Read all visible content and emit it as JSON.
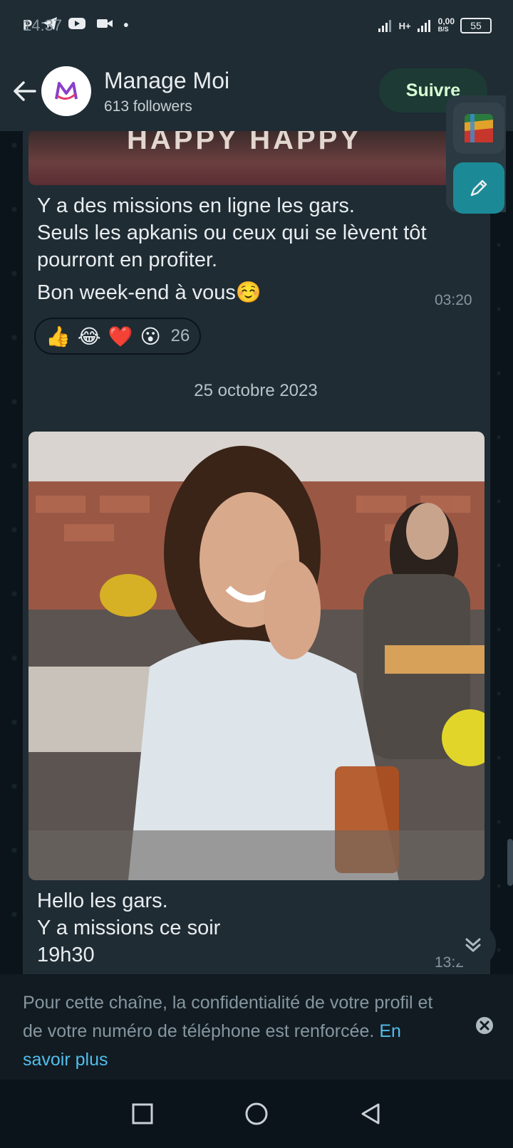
{
  "status_bar": {
    "time": "14:37",
    "network": "H+",
    "speed_value": "0,00",
    "speed_unit": "B/S",
    "battery": "55"
  },
  "header": {
    "channel_name": "Manage Moi",
    "followers": "613 followers",
    "follow_label": "Suivre"
  },
  "messages": [
    {
      "image_caption": "HAPPY HAPPY",
      "lines": [
        "Y a des missions en ligne les gars.",
        "Seuls les apkanis ou ceux qui se lèvent tôt",
        "pourront en profiter.",
        "Bon week-end à vous☺️"
      ],
      "time": "03:20",
      "reactions": [
        "👍",
        "😂",
        "❤️",
        "😮"
      ],
      "reaction_count": "26"
    },
    {
      "lines": [
        "Hello les gars.",
        "Y a missions ce soir",
        "19h30"
      ],
      "time": "13:28"
    }
  ],
  "date_separator": "25 octobre 2023",
  "privacy_notice": {
    "text": "Pour cette chaîne, la confidentialité de votre profil et de votre numéro de téléphone est renforcée.",
    "link": "En savoir plus"
  },
  "colors": {
    "background": "#0b141a",
    "bubble": "#1f2c34",
    "accent_link": "#53bdeb",
    "follow_button": "#1d3b34",
    "edit_fab": "#1b8a96"
  }
}
